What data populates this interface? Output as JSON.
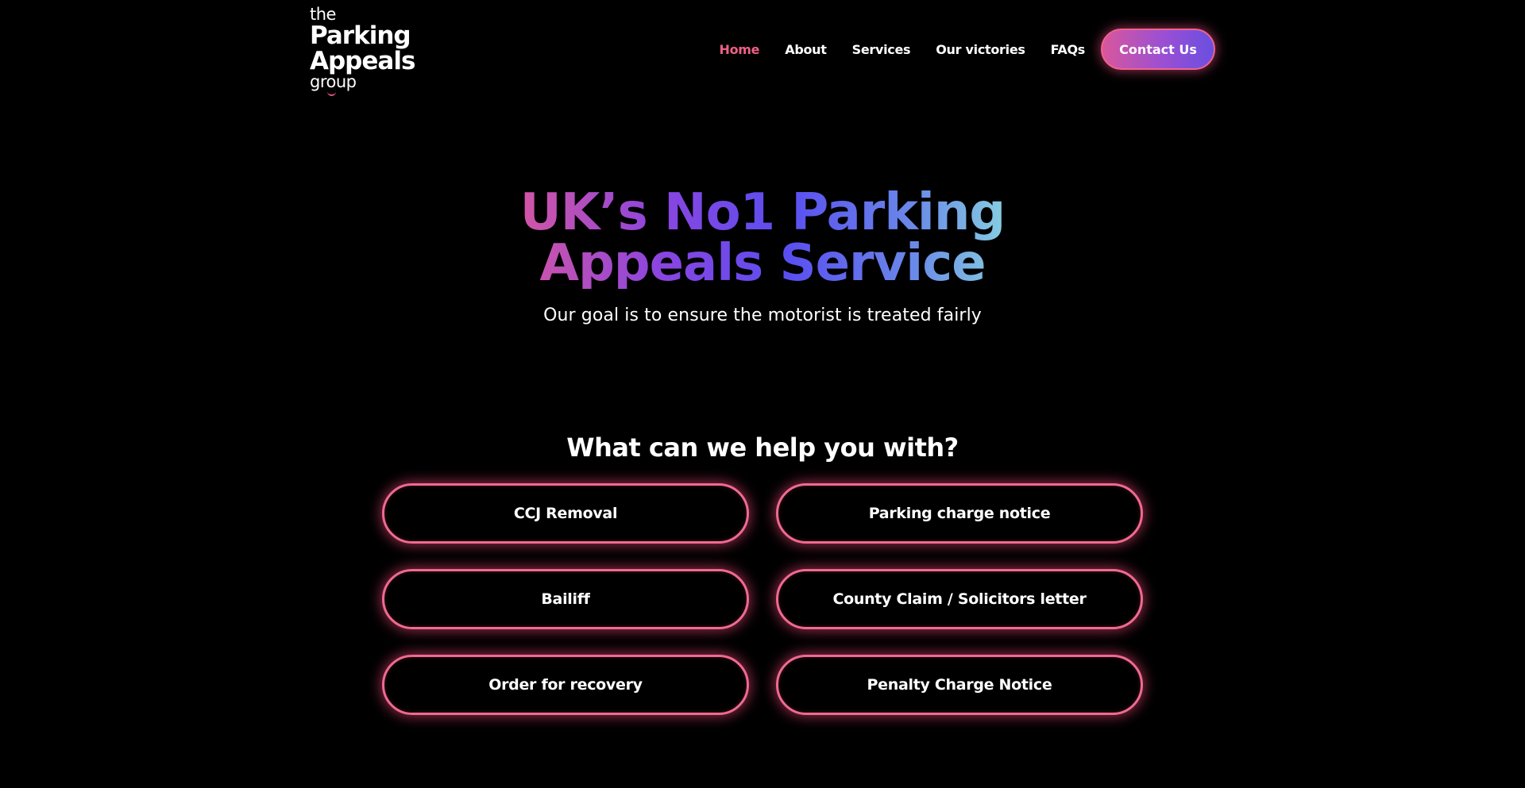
{
  "logo": {
    "line1": "the",
    "line2": "Parking",
    "line3": "Appeals",
    "line4": "group"
  },
  "nav": {
    "items": [
      {
        "label": "Home",
        "active": true
      },
      {
        "label": "About",
        "active": false
      },
      {
        "label": "Services",
        "active": false
      },
      {
        "label": "Our victories",
        "active": false
      },
      {
        "label": "FAQs",
        "active": false
      }
    ],
    "contact_label": "Contact Us"
  },
  "hero": {
    "title_line1": "UK’s No1 Parking",
    "title_line2": "Appeals Service",
    "subtitle": "Our goal is to ensure the motorist is treated fairly"
  },
  "help": {
    "title": "What can we help you with?",
    "options": [
      "CCJ Removal",
      "Parking charge notice",
      "Bailiff",
      "County Claim / Solicitors letter",
      "Order for recovery",
      "Penalty Charge Notice"
    ]
  },
  "colors": {
    "background": "#000000",
    "accent_pink": "#ee5f86",
    "gradient_start": "#d857a0",
    "gradient_mid": "#5a4ef0",
    "gradient_end": "#8ad6e0"
  }
}
